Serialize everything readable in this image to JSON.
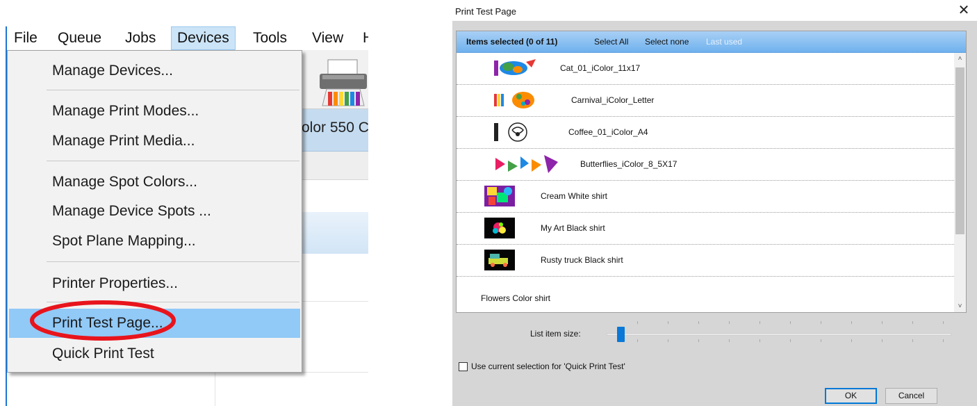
{
  "menubar": {
    "items": [
      "File",
      "Queue",
      "Jobs",
      "Devices",
      "Tools",
      "View",
      "H"
    ],
    "active": "Devices"
  },
  "background": {
    "device_name": "olor 550 C"
  },
  "devices_menu": {
    "items": [
      "Manage Devices...",
      "Manage Print Modes...",
      "Manage Print Media...",
      "Manage Spot Colors...",
      "Manage Device Spots ...",
      "Spot Plane Mapping...",
      "Printer Properties...",
      "Print Test Page...",
      "Quick Print Test"
    ],
    "highlighted": "Print Test Page..."
  },
  "dialog": {
    "title": "Print Test Page",
    "close_icon": "close-icon",
    "header": {
      "items_selected": "Items selected (0 of 11)",
      "select_all": "Select All",
      "select_none": "Select none",
      "last_used": "Last used"
    },
    "items": [
      {
        "name": "Cat_01_iColor_11x17",
        "thumb": "cat-thumbnail"
      },
      {
        "name": "Carnival_iColor_Letter",
        "thumb": "carnival-thumbnail"
      },
      {
        "name": "Coffee_01_iColor_A4",
        "thumb": "coffee-thumbnail"
      },
      {
        "name": "Butterflies_iColor_8_5X17",
        "thumb": "butterflies-thumbnail"
      },
      {
        "name": "Cream White shirt",
        "thumb": "cream-shirt-thumbnail"
      },
      {
        "name": "My Art Black shirt",
        "thumb": "art-shirt-thumbnail"
      },
      {
        "name": "Rusty truck Black shirt",
        "thumb": "truck-shirt-thumbnail"
      },
      {
        "name": "Flowers Color shirt",
        "thumb": ""
      }
    ],
    "list_item_size_label": "List item size:",
    "list_item_size_value": 0.03,
    "checkbox_label": "Use current selection for 'Quick Print Test'",
    "checkbox_checked": false,
    "ok_label": "OK",
    "cancel_label": "Cancel"
  },
  "colors": {
    "menu_highlight": "#91c9f7",
    "annotation_ring": "#e8141c",
    "header_blue": "#6fb1ee",
    "accent": "#0a78d7"
  }
}
